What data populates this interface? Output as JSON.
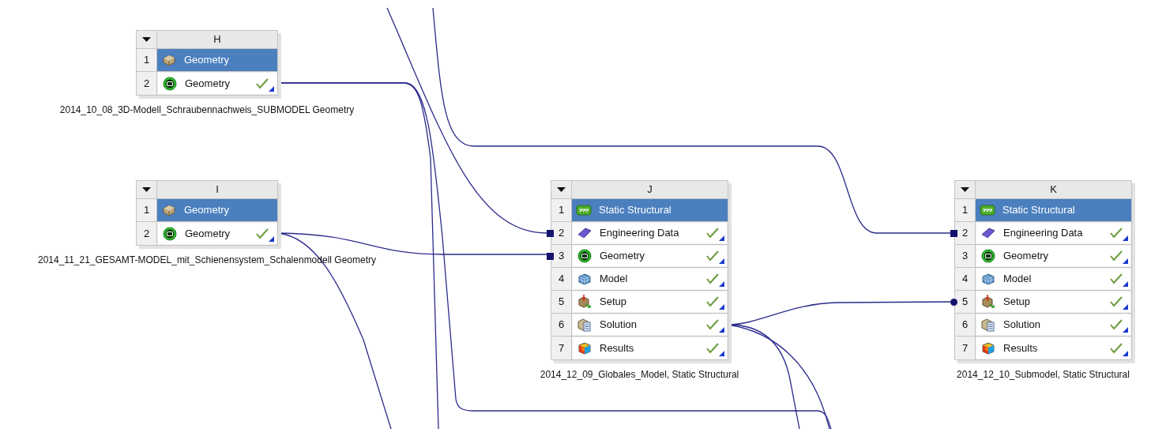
{
  "systems": [
    {
      "letter": "H",
      "caption": "2014_10_08_3D-Modell_Schraubennachweis_SUBMODEL Geometry",
      "title": {
        "number": "1",
        "label": "Geometry",
        "kind": "geometry"
      },
      "cells": [
        {
          "number": "2",
          "label": "Geometry",
          "kind": "dm",
          "up_to_date": true
        }
      ]
    },
    {
      "letter": "I",
      "caption": "2014_11_21_GESAMT-MODEL_mit_Schienensystem_Schalenmodell Geometry",
      "title": {
        "number": "1",
        "label": "Geometry",
        "kind": "geometry"
      },
      "cells": [
        {
          "number": "2",
          "label": "Geometry",
          "kind": "dm",
          "up_to_date": true
        }
      ]
    },
    {
      "letter": "J",
      "caption": "2014_12_09_Globales_Model, Static Structural",
      "title": {
        "number": "1",
        "label": "Static Structural",
        "kind": "static"
      },
      "cells": [
        {
          "number": "2",
          "label": "Engineering Data",
          "kind": "engdata",
          "up_to_date": true,
          "input": {
            "kind": "square"
          }
        },
        {
          "number": "3",
          "label": "Geometry",
          "kind": "dm",
          "up_to_date": true,
          "input": {
            "kind": "square"
          }
        },
        {
          "number": "4",
          "label": "Model",
          "kind": "model",
          "up_to_date": true
        },
        {
          "number": "5",
          "label": "Setup",
          "kind": "setup",
          "up_to_date": true
        },
        {
          "number": "6",
          "label": "Solution",
          "kind": "solution",
          "up_to_date": true
        },
        {
          "number": "7",
          "label": "Results",
          "kind": "results",
          "up_to_date": true
        }
      ]
    },
    {
      "letter": "K",
      "caption": "2014_12_10_Submodel, Static Structural",
      "title": {
        "number": "1",
        "label": "Static Structural",
        "kind": "static"
      },
      "cells": [
        {
          "number": "2",
          "label": "Engineering Data",
          "kind": "engdata",
          "up_to_date": true,
          "input": {
            "kind": "square"
          }
        },
        {
          "number": "3",
          "label": "Geometry",
          "kind": "dm",
          "up_to_date": true
        },
        {
          "number": "4",
          "label": "Model",
          "kind": "model",
          "up_to_date": true
        },
        {
          "number": "5",
          "label": "Setup",
          "kind": "setup",
          "up_to_date": true,
          "input": {
            "kind": "circle"
          }
        },
        {
          "number": "6",
          "label": "Solution",
          "kind": "solution",
          "up_to_date": true
        },
        {
          "number": "7",
          "label": "Results",
          "kind": "results",
          "up_to_date": true
        }
      ]
    }
  ]
}
